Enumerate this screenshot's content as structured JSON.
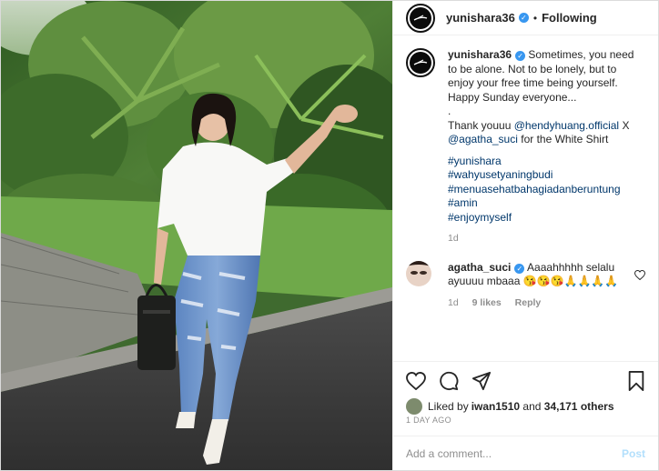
{
  "post": {
    "username": "yunishara36",
    "separator": "•",
    "follow_status": "Following",
    "verified_mark": "✓"
  },
  "caption": {
    "username": "yunishara36",
    "text_1": "Sometimes, you need to be alone. Not to be lonely, but to enjoy your free time being yourself. Happy Sunday everyone...",
    "dot": ".",
    "thanks_prefix": "Thank youuu ",
    "mention_1": "@hendyhuang.official",
    "thanks_mid": " X ",
    "mention_2": "@agatha_suci",
    "thanks_suffix": " for the White Shirt",
    "hashtags": [
      "#yunishara",
      "#wahyusetyaningbudi",
      "#menuasehatbahagiadanberuntung",
      "#amin",
      "#enjoymyself"
    ],
    "age": "1d"
  },
  "comment": {
    "username": "agatha_suci",
    "text": "Aaaahhhhh selalu ayuuuu mbaaa 😘😘😘🙏🙏🙏🙏",
    "age": "1d",
    "likes": "9 likes",
    "reply": "Reply"
  },
  "liked_by": {
    "prefix": "Liked by ",
    "user": "iwan1510",
    "middle": " and ",
    "count": "34,171 others"
  },
  "timestamp": "1 DAY AGO",
  "add_comment": {
    "placeholder": "Add a comment...",
    "post_label": "Post"
  },
  "icons": [
    "heart-icon",
    "comment-icon",
    "share-icon",
    "bookmark-icon",
    "comment-heart-icon",
    "verified-icon"
  ],
  "colors": {
    "link": "#00376b",
    "verified": "#3897f0",
    "muted": "#8e8e8e",
    "post_button": "#b2dffc"
  }
}
